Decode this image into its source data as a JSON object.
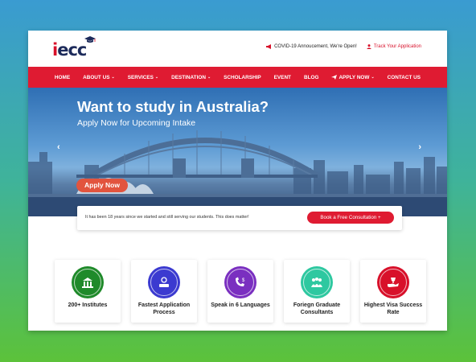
{
  "header": {
    "logo_text": "iecc",
    "covid_link": "COVID-19 Annoucement, We're Open!",
    "track_link": "Track Your Application"
  },
  "nav": {
    "items": [
      {
        "label": "HOME",
        "dropdown": false
      },
      {
        "label": "ABOUT US",
        "dropdown": true
      },
      {
        "label": "SERVICES",
        "dropdown": true
      },
      {
        "label": "DESTINATION",
        "dropdown": true
      },
      {
        "label": "SCHOLARSHIP",
        "dropdown": false
      },
      {
        "label": "EVENT",
        "dropdown": false
      },
      {
        "label": "BLOG",
        "dropdown": false
      },
      {
        "label": "APPLY NOW",
        "dropdown": true
      },
      {
        "label": "CONTACT US",
        "dropdown": false
      }
    ]
  },
  "hero": {
    "title": "Want to study in Australia?",
    "subtitle": "Apply Now for Upcoming Intake",
    "cta": "Apply Now",
    "prev_arrow": "‹",
    "next_arrow": "›"
  },
  "strip": {
    "text": "It has been 18 years since we started and still serving our students. This does matter!",
    "button": "Book a Free Consultation +"
  },
  "features": [
    {
      "label": "200+ Institutes",
      "color": "#1f8a2a",
      "icon": "building-icon"
    },
    {
      "label": "Fastest Application Process",
      "color": "#3b3ad0",
      "icon": "clipboard-icon"
    },
    {
      "label": "Speak in 6 Languages",
      "color": "#7a2fc0",
      "icon": "phone-dollar-icon"
    },
    {
      "label": "Foriegn Graduate Consultants",
      "color": "#2ec8a0",
      "icon": "graduates-icon"
    },
    {
      "label": "Highest Visa Success Rate",
      "color": "#d8102a",
      "icon": "hand-trophy-icon"
    }
  ],
  "colors": {
    "brand_red": "#df1b32",
    "navy": "#1c2a5a"
  }
}
